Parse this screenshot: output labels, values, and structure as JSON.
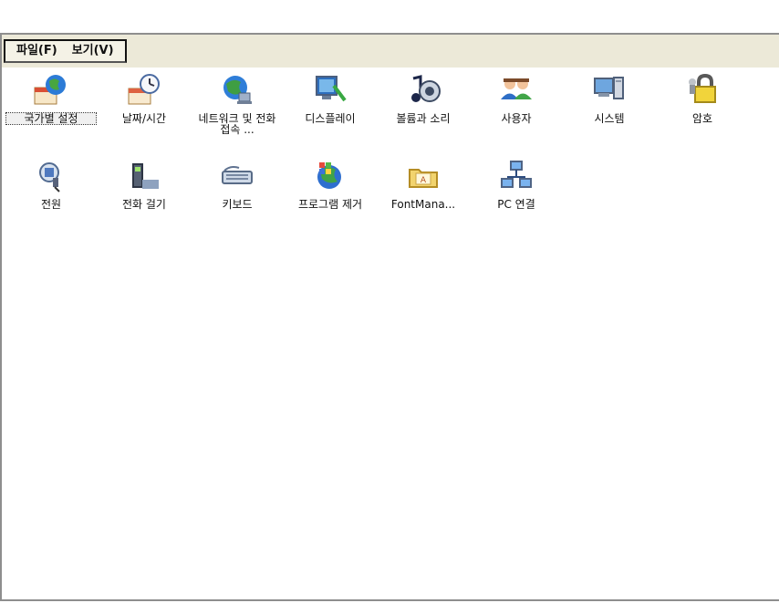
{
  "menu": {
    "file": "파일(F)",
    "view": "보기(V)"
  },
  "icons": [
    {
      "label": "국가별 설정",
      "icon": "globe-calendar-icon"
    },
    {
      "label": "날짜/시간",
      "icon": "clock-calendar-icon"
    },
    {
      "label": "네트워크 및 전화 접속 ...",
      "icon": "network-globe-icon"
    },
    {
      "label": "디스플레이",
      "icon": "display-icon"
    },
    {
      "label": "볼륨과 소리",
      "icon": "music-speaker-icon"
    },
    {
      "label": "사용자",
      "icon": "users-icon"
    },
    {
      "label": "시스템",
      "icon": "system-computer-icon"
    },
    {
      "label": "암호",
      "icon": "password-lock-icon"
    },
    {
      "label": "전원",
      "icon": "power-plug-icon"
    },
    {
      "label": "전화 걸기",
      "icon": "phone-icon"
    },
    {
      "label": "키보드",
      "icon": "keyboard-icon"
    },
    {
      "label": "프로그램 제거",
      "icon": "remove-program-icon"
    },
    {
      "label": "FontMana...",
      "icon": "font-folder-icon"
    },
    {
      "label": "PC 연결",
      "icon": "pc-connect-icon"
    }
  ]
}
